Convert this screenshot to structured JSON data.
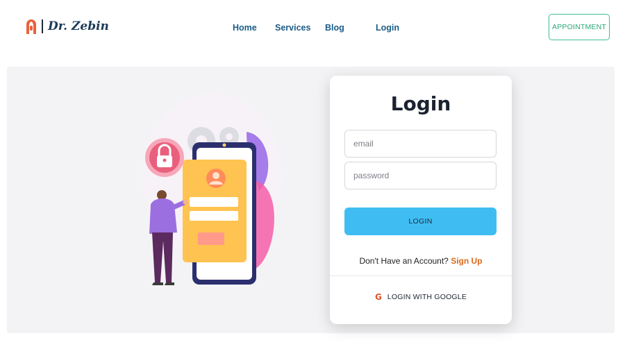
{
  "header": {
    "brand": {
      "name": "Dr. Zebin",
      "logo_icon": "doctor-arch-logo"
    },
    "nav": [
      {
        "label": "Home"
      },
      {
        "label": "Services"
      },
      {
        "label": "Blog"
      },
      {
        "label": "Login"
      }
    ],
    "appointment_label": "APPOINTMENT"
  },
  "login": {
    "title": "Login",
    "email_placeholder": "email",
    "password_placeholder": "password",
    "submit_label": "LOGIN",
    "no_account_text": "Don't Have an Account?",
    "signup_label": "Sign Up",
    "google_icon": "google-g-icon",
    "google_label": "LOGIN WITH GOOGLE"
  },
  "illustration": {
    "subject": "mobile-login-security-illustration"
  },
  "colors": {
    "nav_text": "#1a5c87",
    "appointment_border": "#3fbf8e",
    "login_button": "#3fbdf2",
    "signup_link": "#d9691e",
    "panel_background": "#f3f3f5",
    "logo_orange": "#e8633a"
  }
}
